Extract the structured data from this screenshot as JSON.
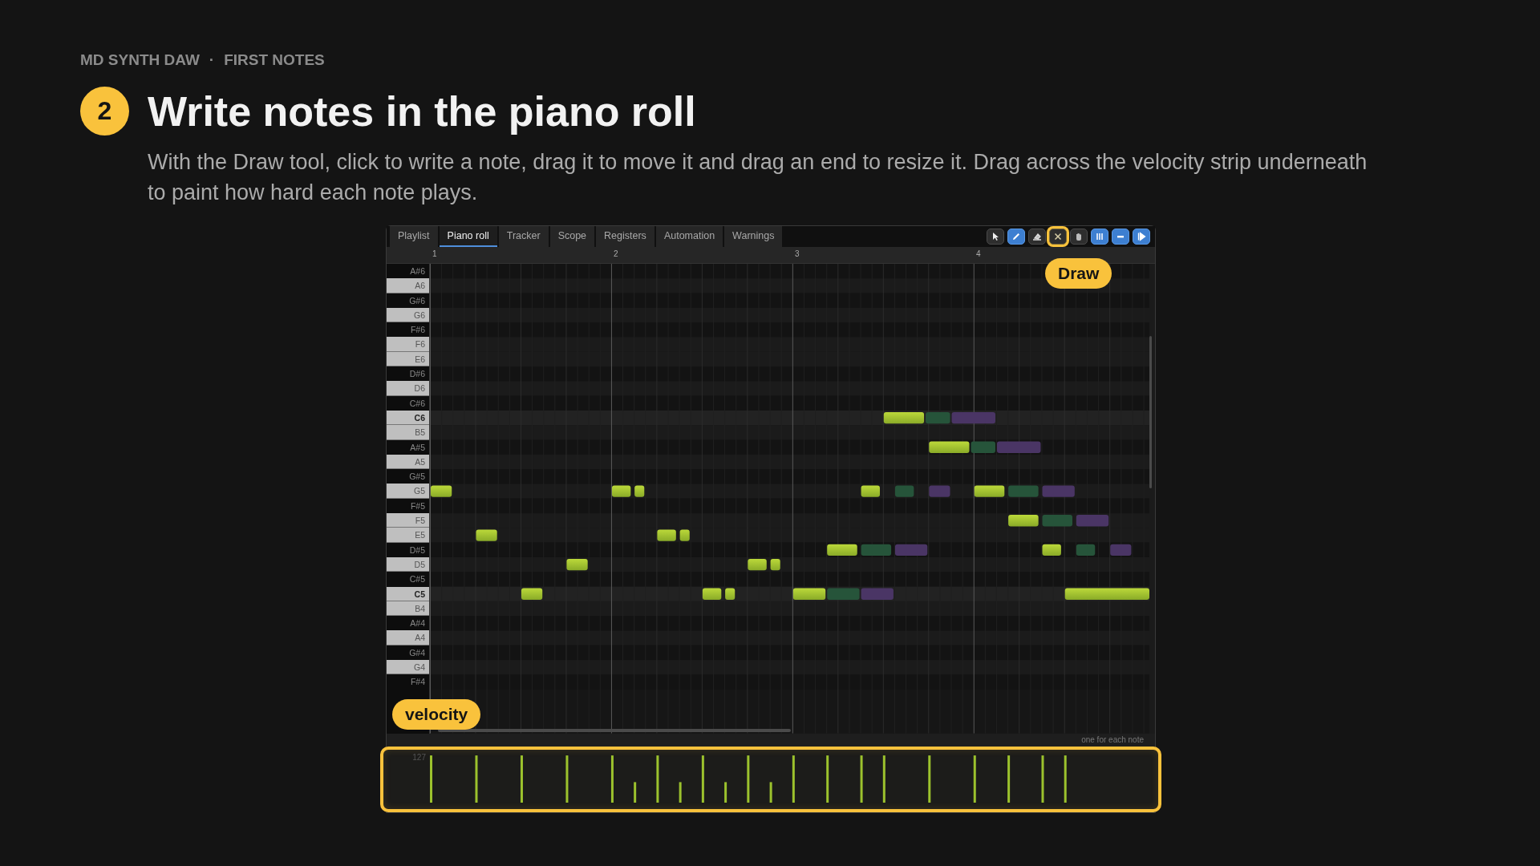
{
  "breadcrumb": {
    "app": "MD SYNTH DAW",
    "separator": "·",
    "section": "FIRST NOTES"
  },
  "step": {
    "number": "2",
    "title": "Write notes in the piano roll",
    "description": "With the Draw tool, click to write a note, drag it to move it and drag an end to resize it. Drag across the velocity strip underneath to paint how hard each note plays."
  },
  "tabs": [
    {
      "label": "Playlist",
      "selected": false
    },
    {
      "label": "Piano roll",
      "selected": true
    },
    {
      "label": "Tracker",
      "selected": false
    },
    {
      "label": "Scope",
      "selected": false
    },
    {
      "label": "Registers",
      "selected": false
    },
    {
      "label": "Automation",
      "selected": false
    },
    {
      "label": "Warnings",
      "selected": false
    }
  ],
  "tools": [
    {
      "kind": "pointer",
      "on": false,
      "highlighted": false
    },
    {
      "kind": "pencil",
      "on": true,
      "highlighted": false
    },
    {
      "kind": "eraser",
      "on": false,
      "highlighted": false
    },
    {
      "kind": "cross",
      "on": false,
      "highlighted": true
    },
    {
      "kind": "hand",
      "on": false,
      "highlighted": false
    },
    {
      "kind": "pause",
      "on": true,
      "highlighted": false
    },
    {
      "kind": "minus",
      "on": true,
      "highlighted": false
    },
    {
      "kind": "play",
      "on": true,
      "highlighted": false
    }
  ],
  "ruler": [
    "1",
    "2",
    "3",
    "4"
  ],
  "keys": [
    {
      "label": "A#6",
      "kind": "black"
    },
    {
      "label": "A6",
      "kind": "white"
    },
    {
      "label": "G#6",
      "kind": "black"
    },
    {
      "label": "G6",
      "kind": "white"
    },
    {
      "label": "F#6",
      "kind": "black"
    },
    {
      "label": "F6",
      "kind": "white"
    },
    {
      "label": "E6",
      "kind": "white"
    },
    {
      "label": "D#6",
      "kind": "black"
    },
    {
      "label": "D6",
      "kind": "white"
    },
    {
      "label": "C#6",
      "kind": "black"
    },
    {
      "label": "C6",
      "kind": "octave"
    },
    {
      "label": "B5",
      "kind": "white"
    },
    {
      "label": "A#5",
      "kind": "black"
    },
    {
      "label": "A5",
      "kind": "white"
    },
    {
      "label": "G#5",
      "kind": "black"
    },
    {
      "label": "G5",
      "kind": "white"
    },
    {
      "label": "F#5",
      "kind": "black"
    },
    {
      "label": "F5",
      "kind": "white"
    },
    {
      "label": "E5",
      "kind": "white"
    },
    {
      "label": "D#5",
      "kind": "black"
    },
    {
      "label": "D5",
      "kind": "white"
    },
    {
      "label": "C#5",
      "kind": "black"
    },
    {
      "label": "C5",
      "kind": "octave"
    },
    {
      "label": "B4",
      "kind": "white"
    },
    {
      "label": "A#4",
      "kind": "black"
    },
    {
      "label": "A4",
      "kind": "white"
    },
    {
      "label": "G#4",
      "kind": "black"
    },
    {
      "label": "G4",
      "kind": "white"
    },
    {
      "label": "F#4",
      "kind": "black"
    }
  ],
  "velocity_strip": {
    "max": "127",
    "hint": "one for each note"
  },
  "callouts": {
    "draw": "Draw",
    "velocity": "velocity"
  }
}
